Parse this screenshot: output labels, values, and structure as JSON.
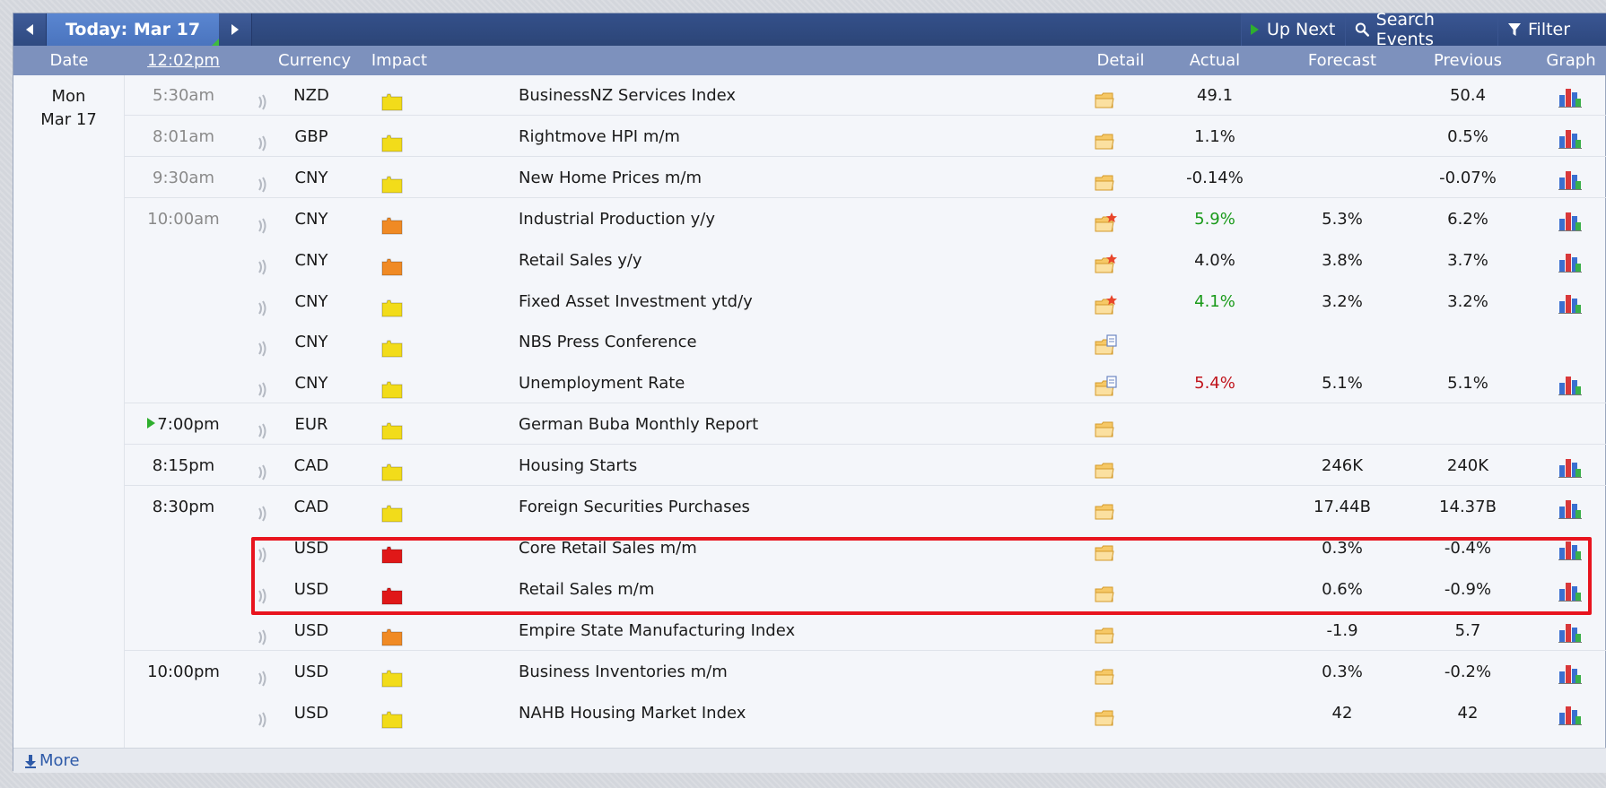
{
  "toolbar": {
    "today_label": "Today: Mar 17",
    "up_next": "Up Next",
    "search_events": "Search Events",
    "filter": "Filter"
  },
  "header": {
    "date": "Date",
    "time": "12:02pm",
    "currency": "Currency",
    "impact": "Impact",
    "detail": "Detail",
    "actual": "Actual",
    "forecast": "Forecast",
    "previous": "Previous",
    "graph": "Graph"
  },
  "date": {
    "day": "Mon",
    "date": "Mar 17"
  },
  "colors": {
    "impact_yellow": "#f2dc1a",
    "impact_orange": "#f08a24",
    "impact_red": "#e01818",
    "actual_better": "#1a9a1a",
    "actual_worse": "#c0141c",
    "highlight": "#e8141e"
  },
  "events": [
    {
      "time": "5:30am",
      "currency": "NZD",
      "impact": "low",
      "impact_color": "#f2dc1a",
      "name": "BusinessNZ Services Index",
      "detail_icon": "folder-icon",
      "actual": "49.1",
      "actual_status": "",
      "forecast": "",
      "previous": "50.4",
      "graph": true
    },
    {
      "time": "8:01am",
      "currency": "GBP",
      "impact": "low",
      "impact_color": "#f2dc1a",
      "name": "Rightmove HPI m/m",
      "detail_icon": "folder-icon",
      "actual": "1.1%",
      "actual_status": "",
      "forecast": "",
      "previous": "0.5%",
      "graph": true
    },
    {
      "time": "9:30am",
      "currency": "CNY",
      "impact": "low",
      "impact_color": "#f2dc1a",
      "name": "New Home Prices m/m",
      "detail_icon": "folder-icon",
      "actual": "-0.14%",
      "actual_status": "",
      "forecast": "",
      "previous": "-0.07%",
      "graph": true
    },
    {
      "time": "10:00am",
      "currency": "CNY",
      "impact": "medium",
      "impact_color": "#f08a24",
      "name": "Industrial Production y/y",
      "detail_icon": "folder-star-icon",
      "actual": "5.9%",
      "actual_status": "better",
      "forecast": "5.3%",
      "previous": "6.2%",
      "graph": true
    },
    {
      "time": "",
      "currency": "CNY",
      "impact": "medium",
      "impact_color": "#f08a24",
      "name": "Retail Sales y/y",
      "detail_icon": "folder-star-icon",
      "actual": "4.0%",
      "actual_status": "",
      "forecast": "3.8%",
      "previous": "3.7%",
      "graph": true
    },
    {
      "time": "",
      "currency": "CNY",
      "impact": "low",
      "impact_color": "#f2dc1a",
      "name": "Fixed Asset Investment ytd/y",
      "detail_icon": "folder-star-icon",
      "actual": "4.1%",
      "actual_status": "better",
      "forecast": "3.2%",
      "previous": "3.2%",
      "graph": true
    },
    {
      "time": "",
      "currency": "CNY",
      "impact": "low",
      "impact_color": "#f2dc1a",
      "name": "NBS Press Conference",
      "detail_icon": "folder-doc-icon",
      "actual": "",
      "actual_status": "",
      "forecast": "",
      "previous": "",
      "graph": false
    },
    {
      "time": "",
      "currency": "CNY",
      "impact": "low",
      "impact_color": "#f2dc1a",
      "name": "Unemployment Rate",
      "detail_icon": "folder-doc-icon",
      "actual": "5.4%",
      "actual_status": "worse",
      "forecast": "5.1%",
      "previous": "5.1%",
      "graph": true
    },
    {
      "time": "7:00pm",
      "time_marker": true,
      "currency": "EUR",
      "impact": "low",
      "impact_color": "#f2dc1a",
      "name": "German Buba Monthly Report",
      "detail_icon": "folder-icon",
      "actual": "",
      "actual_status": "",
      "forecast": "",
      "previous": "",
      "graph": false
    },
    {
      "time": "8:15pm",
      "currency": "CAD",
      "impact": "low",
      "impact_color": "#f2dc1a",
      "name": "Housing Starts",
      "detail_icon": "folder-icon",
      "actual": "",
      "actual_status": "",
      "forecast": "246K",
      "previous": "240K",
      "graph": true
    },
    {
      "time": "8:30pm",
      "currency": "CAD",
      "impact": "low",
      "impact_color": "#f2dc1a",
      "name": "Foreign Securities Purchases",
      "detail_icon": "folder-icon",
      "actual": "",
      "actual_status": "",
      "forecast": "17.44B",
      "previous": "14.37B",
      "graph": true
    },
    {
      "time": "",
      "currency": "USD",
      "impact": "high",
      "impact_color": "#e01818",
      "name": "Core Retail Sales m/m",
      "detail_icon": "folder-icon",
      "actual": "",
      "actual_status": "",
      "forecast": "0.3%",
      "previous": "-0.4%",
      "graph": true
    },
    {
      "time": "",
      "currency": "USD",
      "impact": "high",
      "impact_color": "#e01818",
      "name": "Retail Sales m/m",
      "detail_icon": "folder-icon",
      "actual": "",
      "actual_status": "",
      "forecast": "0.6%",
      "previous": "-0.9%",
      "graph": true
    },
    {
      "time": "",
      "currency": "USD",
      "impact": "medium",
      "impact_color": "#f08a24",
      "name": "Empire State Manufacturing Index",
      "detail_icon": "folder-icon",
      "actual": "",
      "actual_status": "",
      "forecast": "-1.9",
      "previous": "5.7",
      "graph": true
    },
    {
      "time": "10:00pm",
      "currency": "USD",
      "impact": "low",
      "impact_color": "#f2dc1a",
      "name": "Business Inventories m/m",
      "detail_icon": "folder-icon",
      "actual": "",
      "actual_status": "",
      "forecast": "0.3%",
      "previous": "-0.2%",
      "graph": true
    },
    {
      "time": "",
      "currency": "USD",
      "impact": "low",
      "impact_color": "#f2dc1a",
      "name": "NAHB Housing Market Index",
      "detail_icon": "folder-icon",
      "actual": "",
      "actual_status": "",
      "forecast": "42",
      "previous": "42",
      "graph": true
    }
  ],
  "footer": {
    "more": "More"
  }
}
